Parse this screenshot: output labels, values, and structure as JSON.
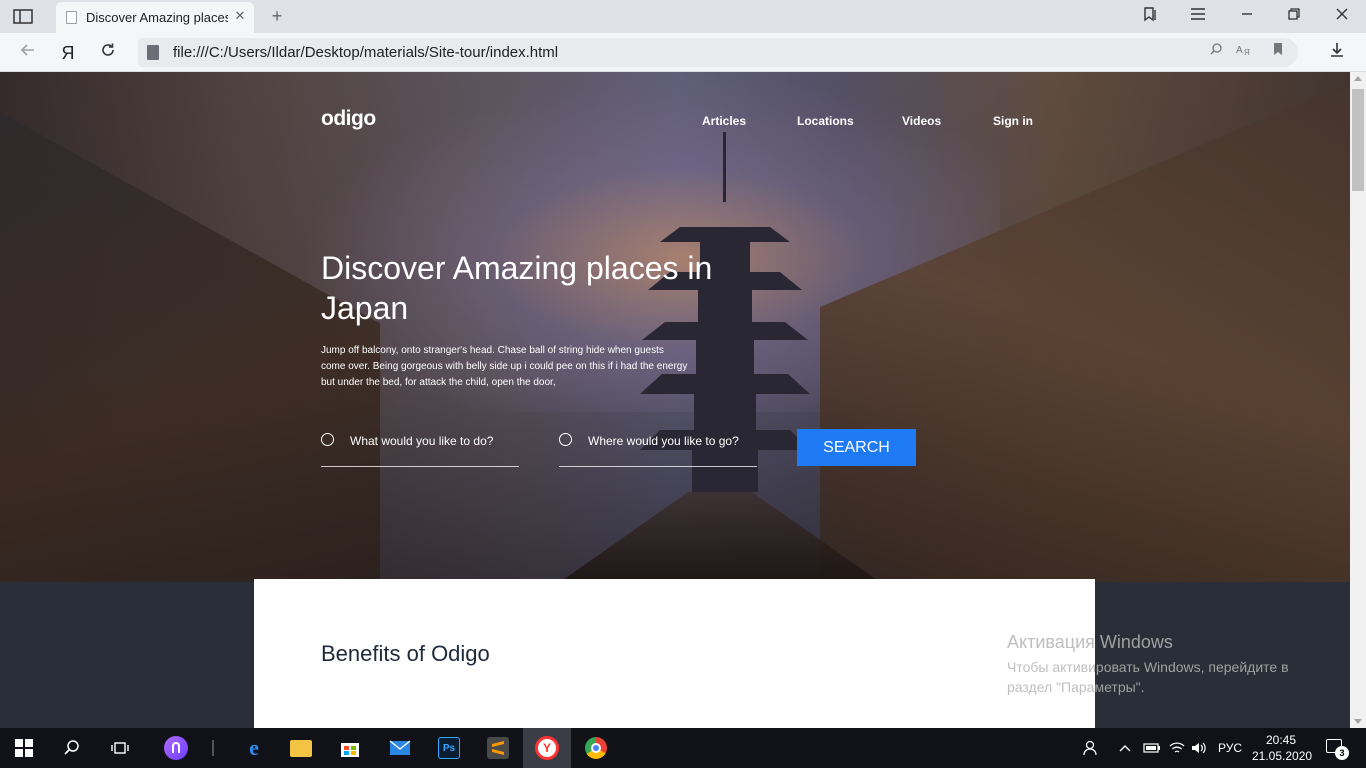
{
  "browser": {
    "tab_title": "Discover Amazing places in Japan",
    "url": "file:///C:/Users/Ildar/Desktop/materials/Site-tour/index.html",
    "yandex_glyph": "Я"
  },
  "site": {
    "logo": "odigo",
    "nav": [
      "Articles",
      "Locations",
      "Videos",
      "Sign in"
    ],
    "hero_title": "Discover Amazing places in Japan",
    "hero_description": "Jump off balcony, onto stranger's head. Chase ball of string hide when guests come over. Being gorgeous with belly side up i could pee on this if i had the energy but under the bed, for attack the child, open the door,",
    "field_activity": "What would you like to do?",
    "field_location": "Where would you like to go?",
    "search_label": "SEARCH",
    "benefits_heading": "Benefits of Odigo"
  },
  "watermark": {
    "title": "Активация Windows",
    "line1": "Чтобы активировать Windows, перейдите в",
    "line2": "раздел \"Параметры\"."
  },
  "taskbar": {
    "language": "РУС",
    "time": "20:45",
    "date": "21.05.2020",
    "notifications": "3"
  },
  "colors": {
    "accent": "#1f7bf5"
  }
}
